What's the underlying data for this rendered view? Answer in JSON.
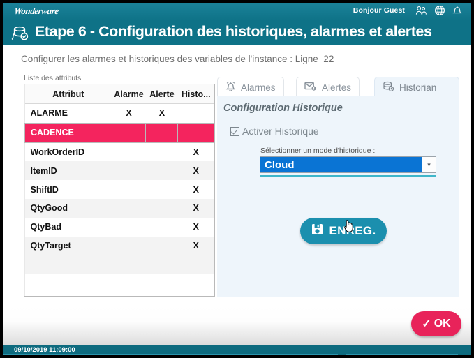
{
  "topbar": {
    "logo_text": "Wonderware",
    "greeting": "Bonjour Guest",
    "icons": [
      "users-icon",
      "globe-icon",
      "bell-icon"
    ]
  },
  "title_band": {
    "icon": "historian-alarm-icon",
    "title": "Etape 6 - Configuration des historiques, alarmes et alertes"
  },
  "instruction": "Configurer les alarmes et historiques des variables de l'instance : Ligne_22",
  "attribute_list": {
    "label": "Liste des attributs",
    "columns": [
      "Attribut",
      "Alarme",
      "Alerte",
      "Histo..."
    ],
    "rows": [
      {
        "attribut": "ALARME",
        "alarme": "X",
        "alerte": "X",
        "historique": "",
        "selected": false
      },
      {
        "attribut": "CADENCE",
        "alarme": "",
        "alerte": "",
        "historique": "",
        "selected": true
      },
      {
        "attribut": "WorkOrderID",
        "alarme": "",
        "alerte": "",
        "historique": "X",
        "selected": false
      },
      {
        "attribut": "ItemID",
        "alarme": "",
        "alerte": "",
        "historique": "X",
        "selected": false
      },
      {
        "attribut": "ShiftID",
        "alarme": "",
        "alerte": "",
        "historique": "X",
        "selected": false
      },
      {
        "attribut": "QtyGood",
        "alarme": "",
        "alerte": "",
        "historique": "X",
        "selected": false
      },
      {
        "attribut": "QtyBad",
        "alarme": "",
        "alerte": "",
        "historique": "X",
        "selected": false
      },
      {
        "attribut": "QtyTarget",
        "alarme": "",
        "alerte": "",
        "historique": "X",
        "selected": false
      }
    ]
  },
  "tabs": [
    {
      "label": "Alarmes",
      "icon": "bell-icon",
      "active": false
    },
    {
      "label": "Alertes",
      "icon": "envelope-icon",
      "active": false
    },
    {
      "label": "Historian",
      "icon": "database-icon",
      "active": true
    }
  ],
  "historian_panel": {
    "title": "Configuration Historique",
    "checkbox_label": "Activer Historique",
    "checkbox_checked": true,
    "select_label": "Sélectionner un mode d'historique :",
    "select_value": "Cloud",
    "select_options": [
      "Cloud"
    ],
    "save_label": "ENREG.",
    "save_icon": "floppy-disk-icon"
  },
  "footer": {
    "ok_label": "OK",
    "ok_check": "✓",
    "timestamp": "09/10/2019 11:09:00"
  },
  "colors": {
    "teal": "#0e7287",
    "teal_light": "#1b8fae",
    "panel_blue": "#eef5fb",
    "select_blue": "#0a74d4",
    "selected_row_pink": "#f4245e",
    "ok_pink": "#e8235a",
    "status_bar": "#0e6b7f"
  }
}
